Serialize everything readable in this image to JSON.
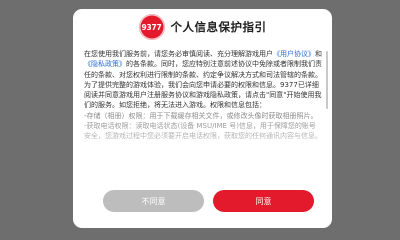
{
  "dialog": {
    "logo_text": "9377",
    "title": "个人信息保护指引",
    "intro_before_link1": "在您使用我们服务前，请您务必审慎阅读、充分理解游戏用户",
    "link1": "《用户协议》",
    "between_links": "和",
    "link2": "《隐私政策》",
    "intro_after_links": "的各条款。同时，您应特别注意前述协议中免除或者限制我们责任的条款、对您权利进行限制的条款、约定争议解决方式和司法管辖的条款。为了提供完整的游戏体验，我们会向您申请必要的权限和信息。9377已详细阅读并同意游戏用户注册服务协议和游戏隐私政策，请点击\"同意\"开始使用我们的服务。如您拒绝，将无法进入游戏。权限和信息包括：",
    "item_storage": "-存储（相册）权限：用于下载缓存相关文件，或修改头像时获取相册照片。",
    "item_phone": "-获取电话权限：读取电话状态(设备 MSU/IME 号)信息，用于保障您的账号安全，您游戏过程中您必须要开启电话权限，获取您的任何通讯内容与信息。"
  },
  "buttons": {
    "decline_label": "不同意",
    "accept_label": "同意"
  },
  "colors": {
    "accent": "#e31a2b",
    "link": "#2b6fd6",
    "decline": "#bdbdbd",
    "backdrop": "#6e6e6e"
  }
}
